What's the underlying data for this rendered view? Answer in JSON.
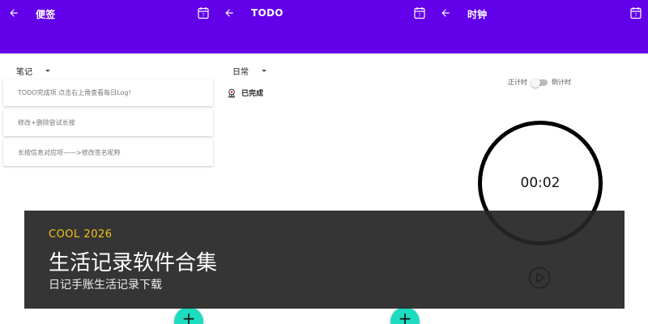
{
  "panels": [
    {
      "title": "便签",
      "dropdown": "笔记",
      "notes": [
        "TODO完成项 点击右上角查看每日Log!",
        "修改+删除尝试长按",
        "长按信息对应项——>修改签名昵称"
      ]
    },
    {
      "title": "TODO",
      "dropdown": "日常",
      "done_label": "已完成"
    },
    {
      "title": "时钟",
      "switch_left": "正计时",
      "switch_right": "倒计时",
      "time": "00:02"
    }
  ],
  "fab_label": "+",
  "banner": {
    "tag": "COOL 2026",
    "title": "生活记录软件合集",
    "subtitle": "日记手账生活记录下载"
  },
  "colors": {
    "appbar": "#6200ea",
    "fab": "#1ddcc0",
    "banner_bg": "#262626",
    "banner_tag": "#f2c316"
  },
  "icons": {
    "back": "arrow-left-icon",
    "calendar": "calendar-icon",
    "done": "award-icon",
    "play": "play-circle-icon",
    "dropdown": "caret-down-icon"
  }
}
